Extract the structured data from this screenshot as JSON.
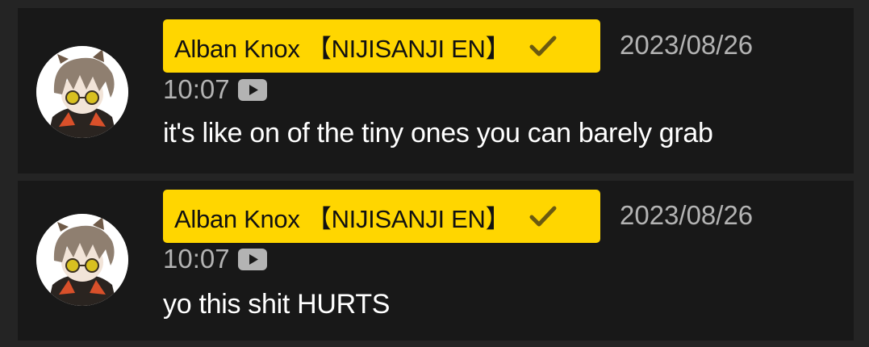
{
  "messages": [
    {
      "author": "Alban Knox 【NIJISANJI EN】",
      "date": "2023/08/26",
      "time": "10:07",
      "text": "it's like on of the tiny ones you can barely grab",
      "avatar_icon": "avatar-icon",
      "verified_icon": "checkmark-icon",
      "source_icon": "youtube-icon"
    },
    {
      "author": "Alban Knox 【NIJISANJI EN】",
      "date": "2023/08/26",
      "time": "10:07",
      "text": "yo this shit HURTS",
      "avatar_icon": "avatar-icon",
      "verified_icon": "checkmark-icon",
      "source_icon": "youtube-icon"
    }
  ],
  "colors": {
    "background": "#242424",
    "card": "#181818",
    "author_badge": "#ffd600",
    "author_text": "#111111",
    "meta_text": "#b3b3b3",
    "message_text": "#ffffff"
  }
}
